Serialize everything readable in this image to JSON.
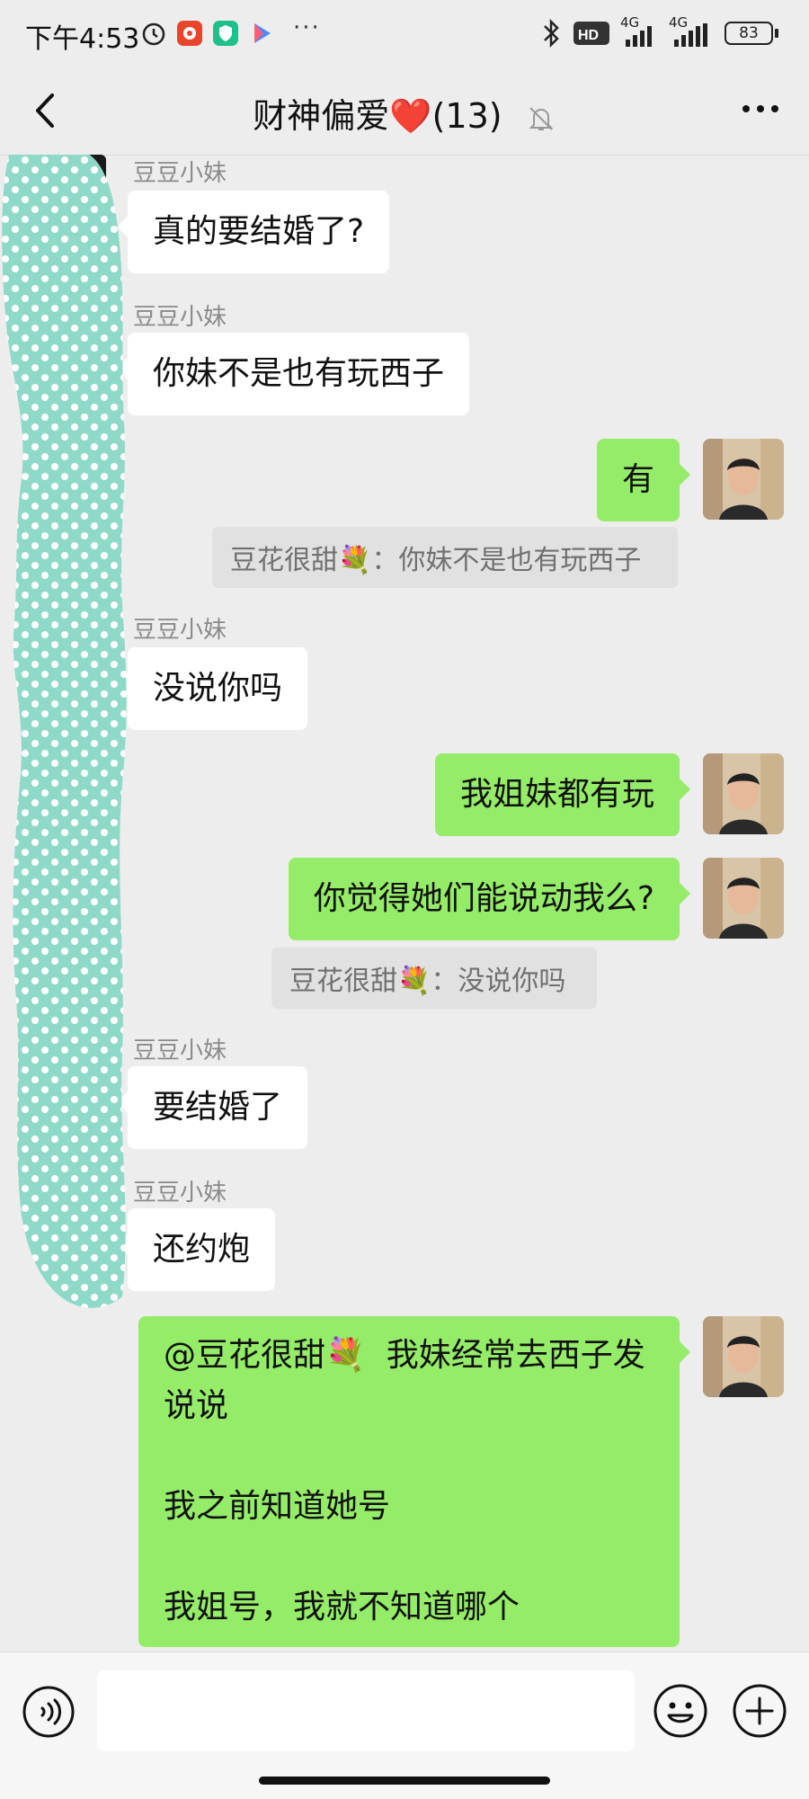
{
  "status_bar": {
    "time": "下午4:53",
    "network_1": "4G",
    "network_2": "4G",
    "battery": "83"
  },
  "header": {
    "title": "财神偏爱❤️(13)"
  },
  "messages": [
    {
      "type": "incoming",
      "sender": "豆豆小妹",
      "text": "真的要结婚了?"
    },
    {
      "type": "incoming",
      "sender": "豆豆小妹",
      "text": "你妹不是也有玩西子"
    },
    {
      "type": "outgoing",
      "text": "有"
    },
    {
      "type": "quote",
      "text": "豆花很甜💐：你妹不是也有玩西子"
    },
    {
      "type": "incoming",
      "sender": "豆豆小妹",
      "text": "没说你吗"
    },
    {
      "type": "outgoing",
      "text": "我姐妹都有玩"
    },
    {
      "type": "outgoing",
      "text": "你觉得她们能说动我么?"
    },
    {
      "type": "quote",
      "text": "豆花很甜💐：没说你吗"
    },
    {
      "type": "incoming",
      "sender": "豆豆小妹",
      "text": "要结婚了"
    },
    {
      "type": "incoming",
      "sender": "豆豆小妹",
      "text": "还约炮"
    },
    {
      "type": "outgoing",
      "text": "@豆花很甜💐  我妹经常去西子发说说\n\n我之前知道她号\n\n我姐号，我就不知道哪个"
    }
  ],
  "icons": {
    "back": "chevron-left-icon",
    "mute": "bell-off-icon",
    "more": "more-dots-icon",
    "voice": "voice-icon",
    "emoji": "emoji-icon",
    "plus": "plus-icon"
  },
  "colors": {
    "outgoing_bubble": "#95ec69",
    "incoming_bubble": "#ffffff",
    "background": "#ededed",
    "redaction": "#8fd9c9"
  }
}
